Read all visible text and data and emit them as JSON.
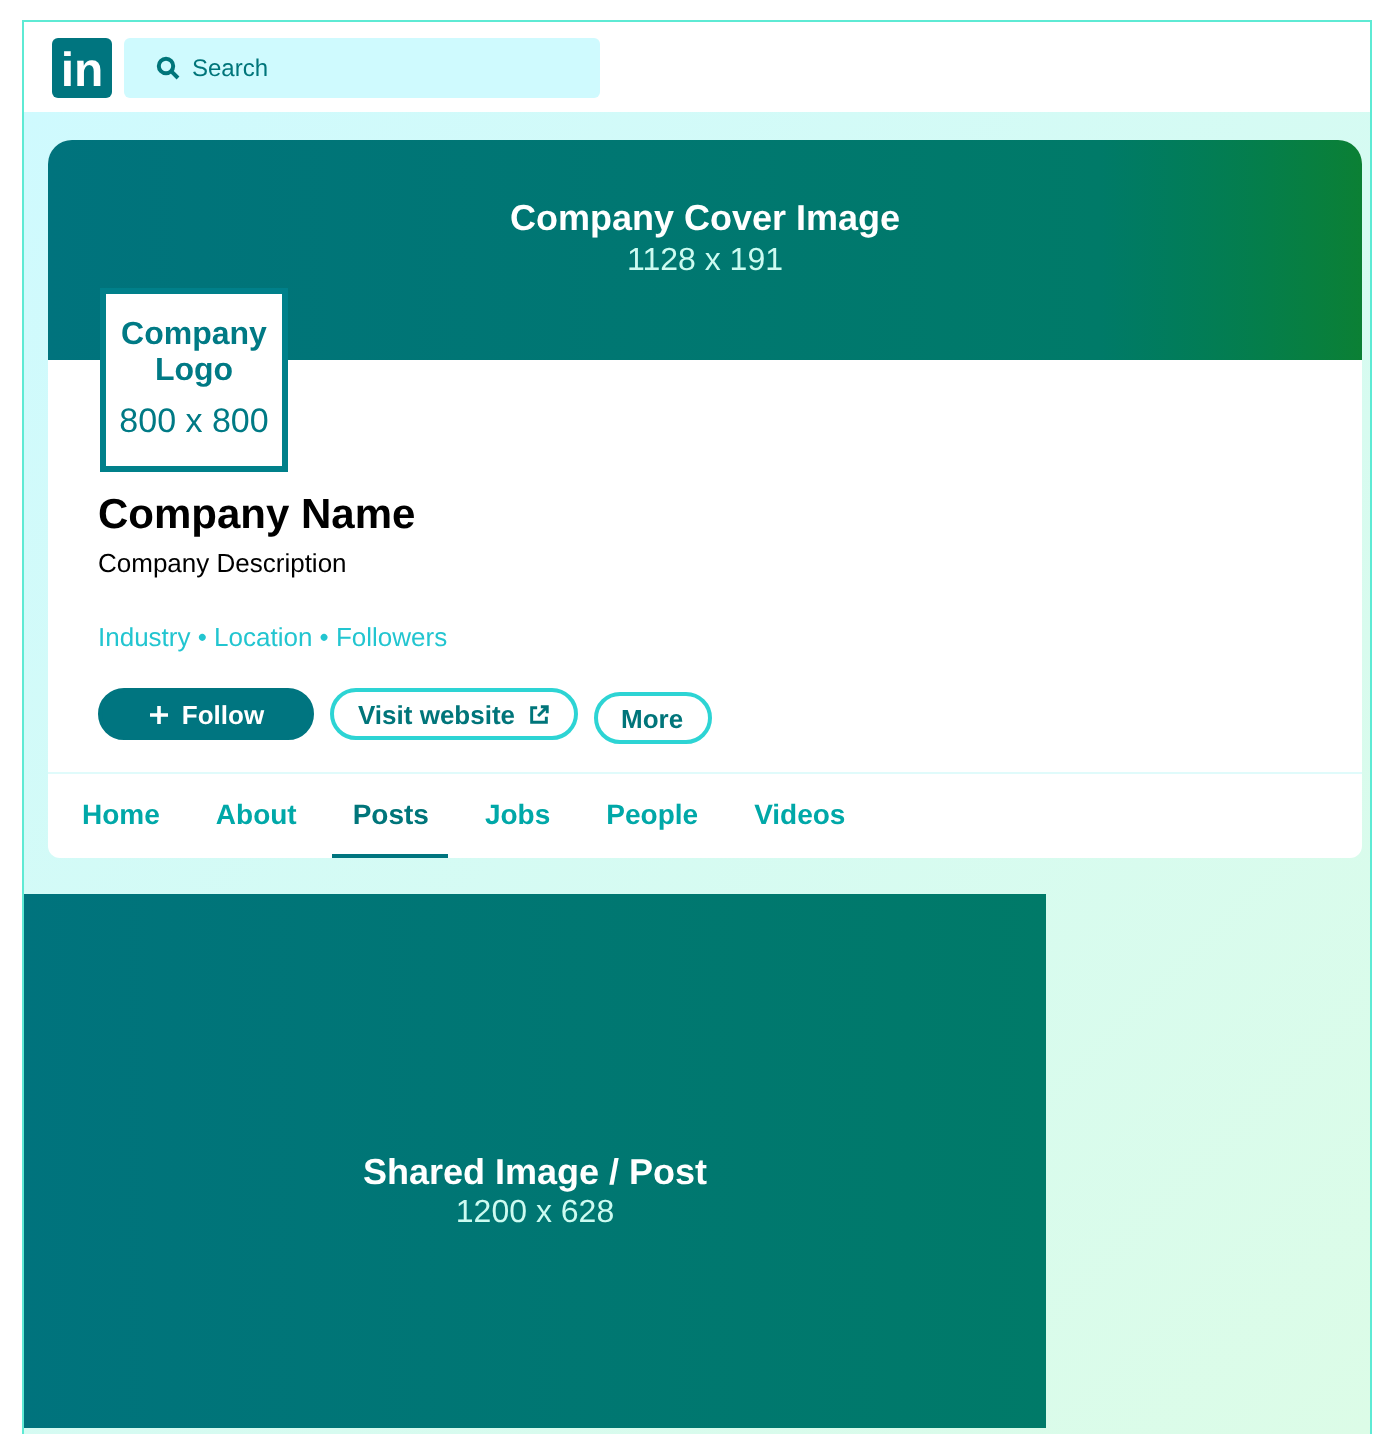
{
  "header": {
    "logo": "in",
    "search": {
      "placeholder": "Search"
    }
  },
  "cover": {
    "title": "Company Cover Image",
    "size": "1128 x 191"
  },
  "logo_box": {
    "title": "Company Logo",
    "size": "800 x 800"
  },
  "company": {
    "name": "Company Name",
    "description": "Company Description",
    "meta": "Industry • Location • Followers"
  },
  "buttons": [
    {
      "kind": "primary",
      "label": "Follow"
    },
    {
      "kind": "link",
      "label": "Visit website"
    },
    {
      "kind": "outline",
      "label": "More"
    }
  ],
  "tabs": [
    {
      "label": "Home",
      "selected": false
    },
    {
      "label": "About",
      "selected": false
    },
    {
      "label": "Posts",
      "selected": true
    },
    {
      "label": "Jobs",
      "selected": false
    },
    {
      "label": "People",
      "selected": false
    },
    {
      "label": "Videos",
      "selected": false
    }
  ],
  "shared_post": {
    "title": "Shared Image / Post",
    "size": "1200 x 628"
  }
}
